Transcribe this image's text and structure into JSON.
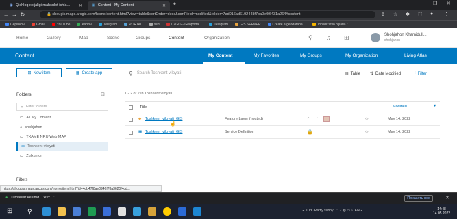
{
  "browser": {
    "tabs": [
      {
        "title": "Qishloq xo'jaligi mahsulot ishla...",
        "active": false
      },
      {
        "title": "Content - My Content",
        "active": true
      }
    ],
    "url": "shougis.maps.arcgis.com/home/content.html?view=table&sortOrder=desc&sortField=modified&folder=7ad016ad6192448f7ba0e0f6431a264#content",
    "bookmarks": [
      "Сервисы",
      "Gmail",
      "YouTube",
      "Карты",
      "Telegram",
      "PORTAL",
      "ssd",
      "UZGIS - Geoportal...",
      "Telegram",
      "GIS SERVER",
      "Create a geodataba...",
      "Topildizinvo hijlaria t..."
    ]
  },
  "header": {
    "nav": [
      "Home",
      "Gallery",
      "Map",
      "Scene",
      "Groups",
      "Content",
      "Organization"
    ],
    "user_name": "Shohjahon Khamidull...",
    "user_sub": "shohjahon"
  },
  "band": {
    "title": "Content",
    "tabs": [
      "My Content",
      "My Favorites",
      "My Groups",
      "My Organization",
      "Living Atlas"
    ]
  },
  "toolbar": {
    "new_item": "New item",
    "create_app": "Create app",
    "search_placeholder": "Search Toshkent viloyati",
    "table": "Table",
    "date_modified": "Date Modified",
    "filter": "Filter"
  },
  "sidebar": {
    "folders_label": "Folders",
    "filter_placeholder": "Filter folders",
    "items": [
      "All My Content",
      "shohjahon",
      "TXAME NRU Web MAP",
      "Toshkent viloyati",
      "Zulxumor"
    ],
    "filters_label": "Filters"
  },
  "table": {
    "count": "1 - 2 of 2 in Toshkent viloyati",
    "col_title": "Title",
    "col_modified": "Modified",
    "rows": [
      {
        "title": "Toshkent_viloyati_GIS",
        "type": "Feature Layer (hosted)",
        "modified": "May 14, 2022"
      },
      {
        "title": "Toshkent_viloyati_GIS",
        "type": "Service Definition",
        "modified": "May 14, 2022"
      }
    ]
  },
  "status_url": "https://shougis.maps.arcgis.com/home/item.html?id=4db47f8ae0946f78a3620f4cd...",
  "download": {
    "file": "Tumanlar kesimd....xlsx",
    "show_all": "Показать все"
  },
  "taskbar": {
    "tray": "10°C Partly sunny",
    "lang": "ENG",
    "time": "14:48",
    "date": "14.05.2022"
  }
}
